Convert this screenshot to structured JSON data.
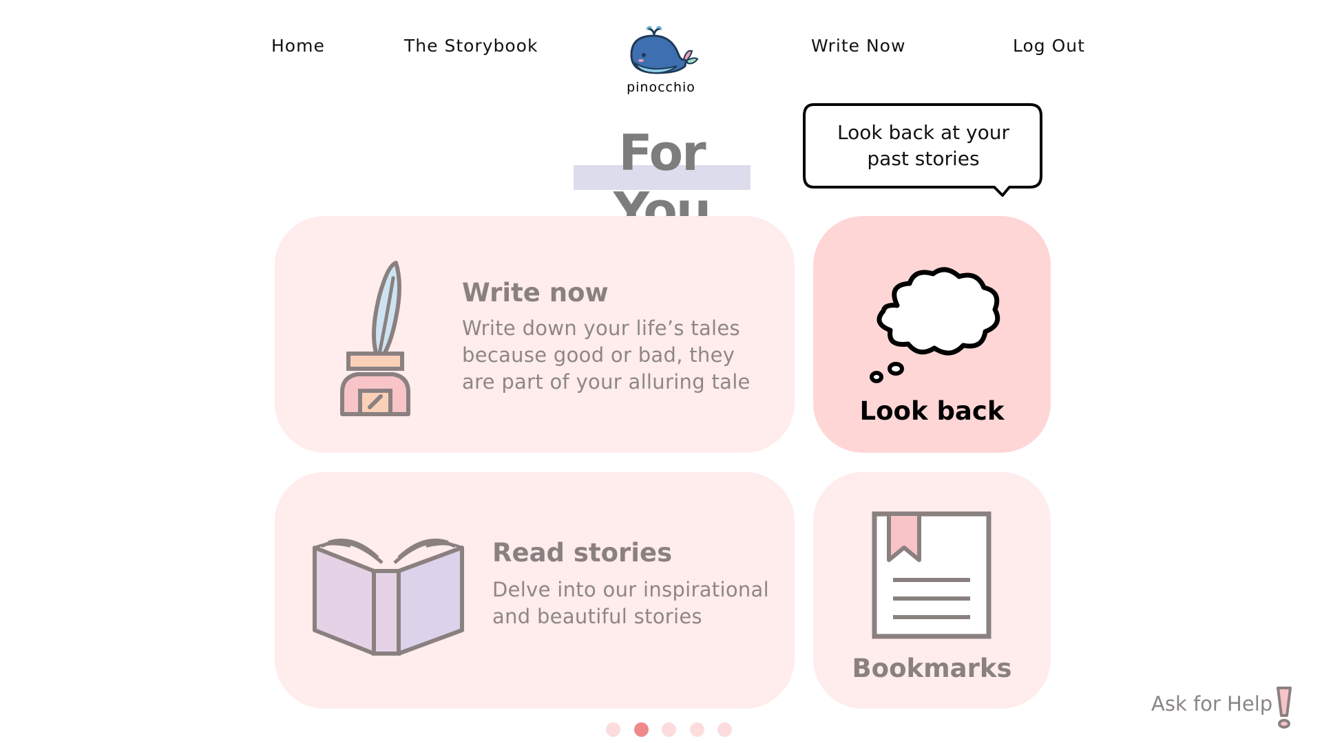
{
  "nav": {
    "home": "Home",
    "storybook": "The Storybook",
    "write_now": "Write Now",
    "log_out": "Log Out"
  },
  "logo": {
    "name": "pinocchio",
    "icon": "whale-icon"
  },
  "page": {
    "heading": "For You"
  },
  "tooltip": {
    "line1": "Look back at your",
    "line2": "past stories"
  },
  "cards": {
    "write": {
      "title": "Write now",
      "desc_lines": [
        "Write down your life’s tales",
        "because good or bad, they",
        "are part of your alluring tale"
      ],
      "icon": "quill-inkpot-icon"
    },
    "read": {
      "title": "Read stories",
      "desc_lines": [
        "Delve into our inspirational",
        "and beautiful stories"
      ],
      "icon": "open-book-icon"
    },
    "look_back": {
      "title": "Look back",
      "icon": "thought-cloud-icon"
    },
    "bookmarks": {
      "title": "Bookmarks",
      "icon": "bookmark-page-icon"
    }
  },
  "pagination": {
    "count": 5,
    "active_index": 1
  },
  "help": {
    "label": "Ask for Help",
    "icon": "exclamation-icon"
  },
  "colors": {
    "card_bg": "#ffecec",
    "card_active_bg": "#ffd6d6",
    "dot_active": "#ee8a8a",
    "dot_inactive": "#fcdcdc",
    "heading_highlight": "#dcdcec"
  }
}
